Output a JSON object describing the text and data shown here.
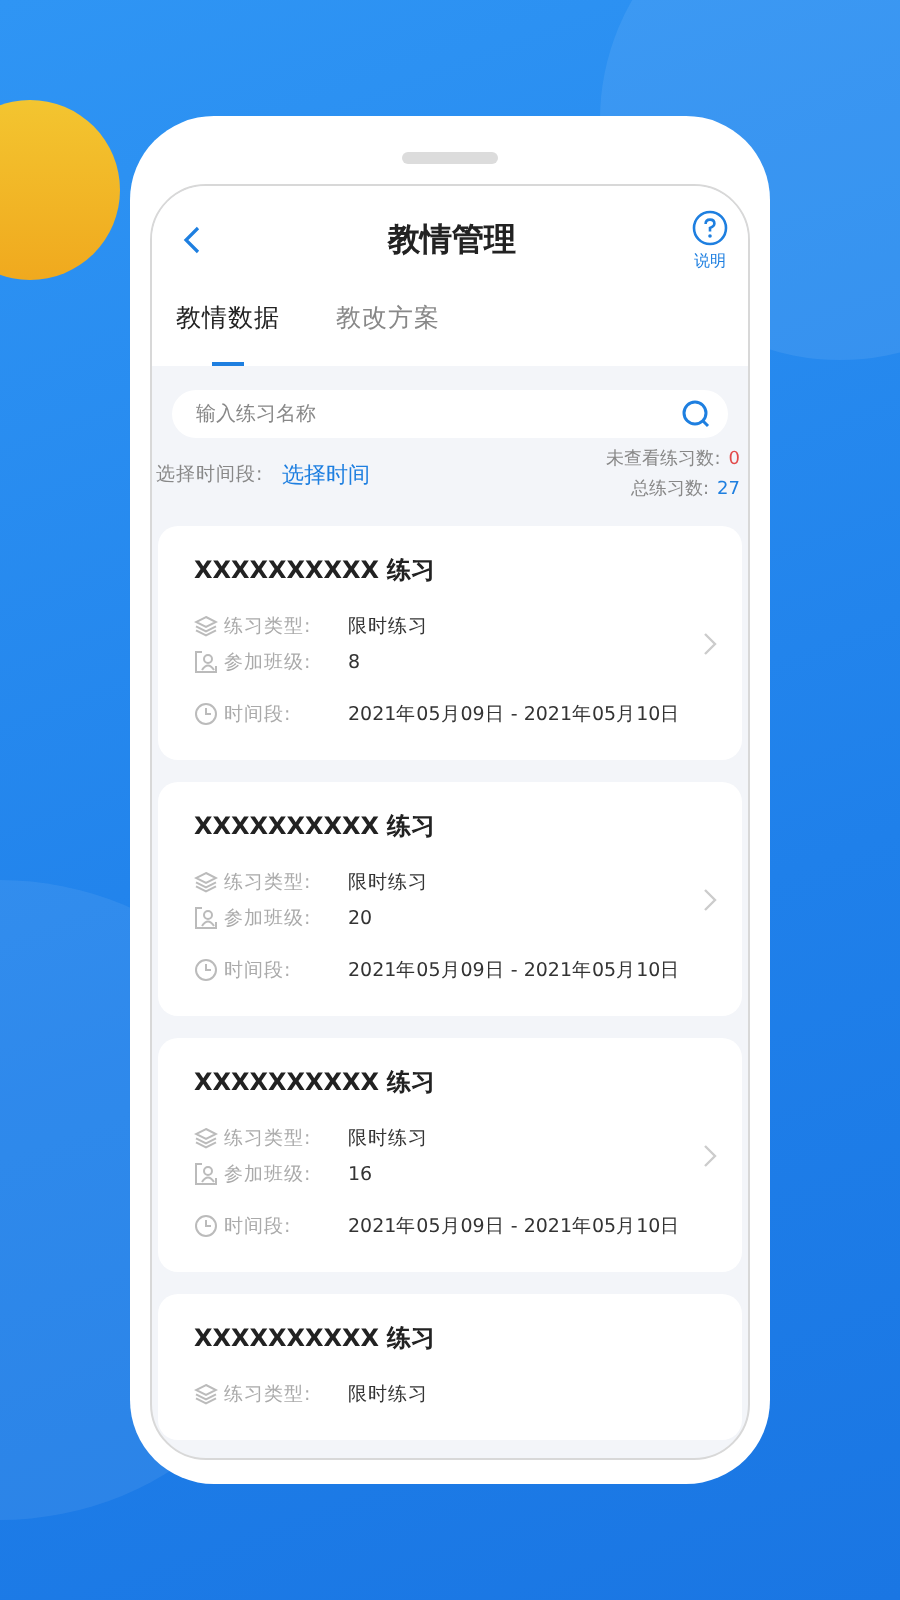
{
  "header": {
    "title": "教情管理",
    "help_label": "说明"
  },
  "tabs": [
    {
      "label": "教情数据",
      "selected": true
    },
    {
      "label": "教改方案",
      "selected": false
    }
  ],
  "search": {
    "placeholder": "输入练习名称"
  },
  "filter": {
    "label": "选择时间段:",
    "value": "选择时间"
  },
  "counts": [
    {
      "label": "未查看练习数:",
      "value": "0",
      "kind": "alert"
    },
    {
      "label": "总练习数:",
      "value": "27",
      "kind": "total"
    }
  ],
  "cards": [
    {
      "title": "XXXXXXXXXX 练习",
      "type_label": "练习类型:",
      "type": "限时练习",
      "class_label": "参加班级:",
      "class": "8",
      "time_label": "时间段:",
      "time": "2021年05月09日 - 2021年05月10日"
    },
    {
      "title": "XXXXXXXXXX 练习",
      "type_label": "练习类型:",
      "type": "限时练习",
      "class_label": "参加班级:",
      "class": "20",
      "time_label": "时间段:",
      "time": "2021年05月09日 - 2021年05月10日"
    },
    {
      "title": "XXXXXXXXXX 练习",
      "type_label": "练习类型:",
      "type": "限时练习",
      "class_label": "参加班级:",
      "class": "16",
      "time_label": "时间段:",
      "time": "2021年05月09日 - 2021年05月10日"
    },
    {
      "title": "XXXXXXXXXX 练习",
      "type_label": "练习类型:",
      "type": "限时练习"
    }
  ]
}
